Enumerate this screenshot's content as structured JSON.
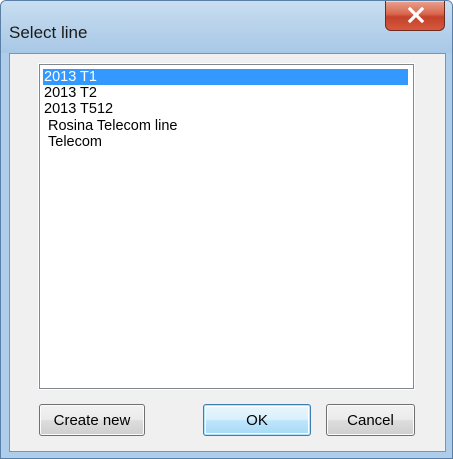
{
  "window": {
    "title": "Select line"
  },
  "list": {
    "items": [
      {
        "label": "2013 T1",
        "selected": true
      },
      {
        "label": "2013 T2",
        "selected": false
      },
      {
        "label": "2013 T512",
        "selected": false
      },
      {
        "label": "Rosina Telecom line",
        "selected": false
      },
      {
        "label": "Telecom",
        "selected": false
      }
    ]
  },
  "buttons": {
    "create_new": "Create new",
    "ok": "OK",
    "cancel": "Cancel"
  },
  "colors": {
    "selection": "#3399ff",
    "close_button": "#c4412a"
  }
}
